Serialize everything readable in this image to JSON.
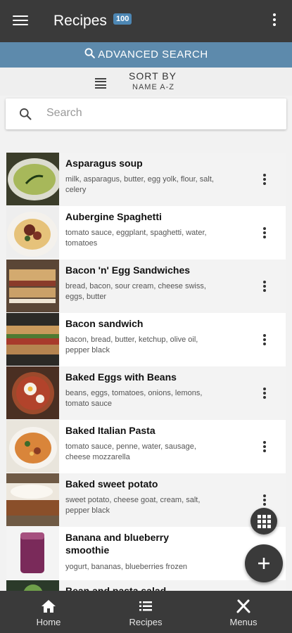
{
  "app": {
    "title": "Recipes",
    "count_badge": "100"
  },
  "advanced_search": {
    "label": "ADVANCED SEARCH"
  },
  "sort": {
    "label": "SORT BY",
    "value": "NAME A-Z"
  },
  "search": {
    "placeholder": "Search"
  },
  "recipes": [
    {
      "name": "Asparagus soup",
      "ingredients": "milk, asparagus, butter, egg yolk, flour, salt, celery"
    },
    {
      "name": "Aubergine Spaghetti",
      "ingredients": "tomato sauce, eggplant, spaghetti, water, tomatoes"
    },
    {
      "name": "Bacon 'n' Egg Sandwiches",
      "ingredients": "bread, bacon, sour cream, cheese swiss, eggs, butter"
    },
    {
      "name": "Bacon sandwich",
      "ingredients": "bacon, bread, butter, ketchup, olive oil, pepper black"
    },
    {
      "name": "Baked Eggs with Beans",
      "ingredients": "beans, eggs, tomatoes, onions, lemons, tomato sauce"
    },
    {
      "name": "Baked Italian Pasta",
      "ingredients": "tomato sauce, penne, water, sausage, cheese mozzarella"
    },
    {
      "name": "Baked sweet potato",
      "ingredients": "sweet potato, cheese goat, cream, salt, pepper black"
    },
    {
      "name": "Banana and blueberry smoothie",
      "ingredients": "yogurt, bananas, blueberries frozen"
    },
    {
      "name": "Bean and pasta salad",
      "ingredients": ""
    }
  ],
  "nav": {
    "home": "Home",
    "recipes": "Recipes",
    "menus": "Menus"
  },
  "colors": {
    "appbar": "#3a3a3a",
    "accent": "#5d8aac",
    "badge": "#4d87b4"
  },
  "icons": [
    "menu-icon",
    "more-vert-icon",
    "search-icon",
    "sort-icon",
    "grid-icon",
    "add-icon",
    "home-icon",
    "list-icon",
    "utensils-icon"
  ]
}
